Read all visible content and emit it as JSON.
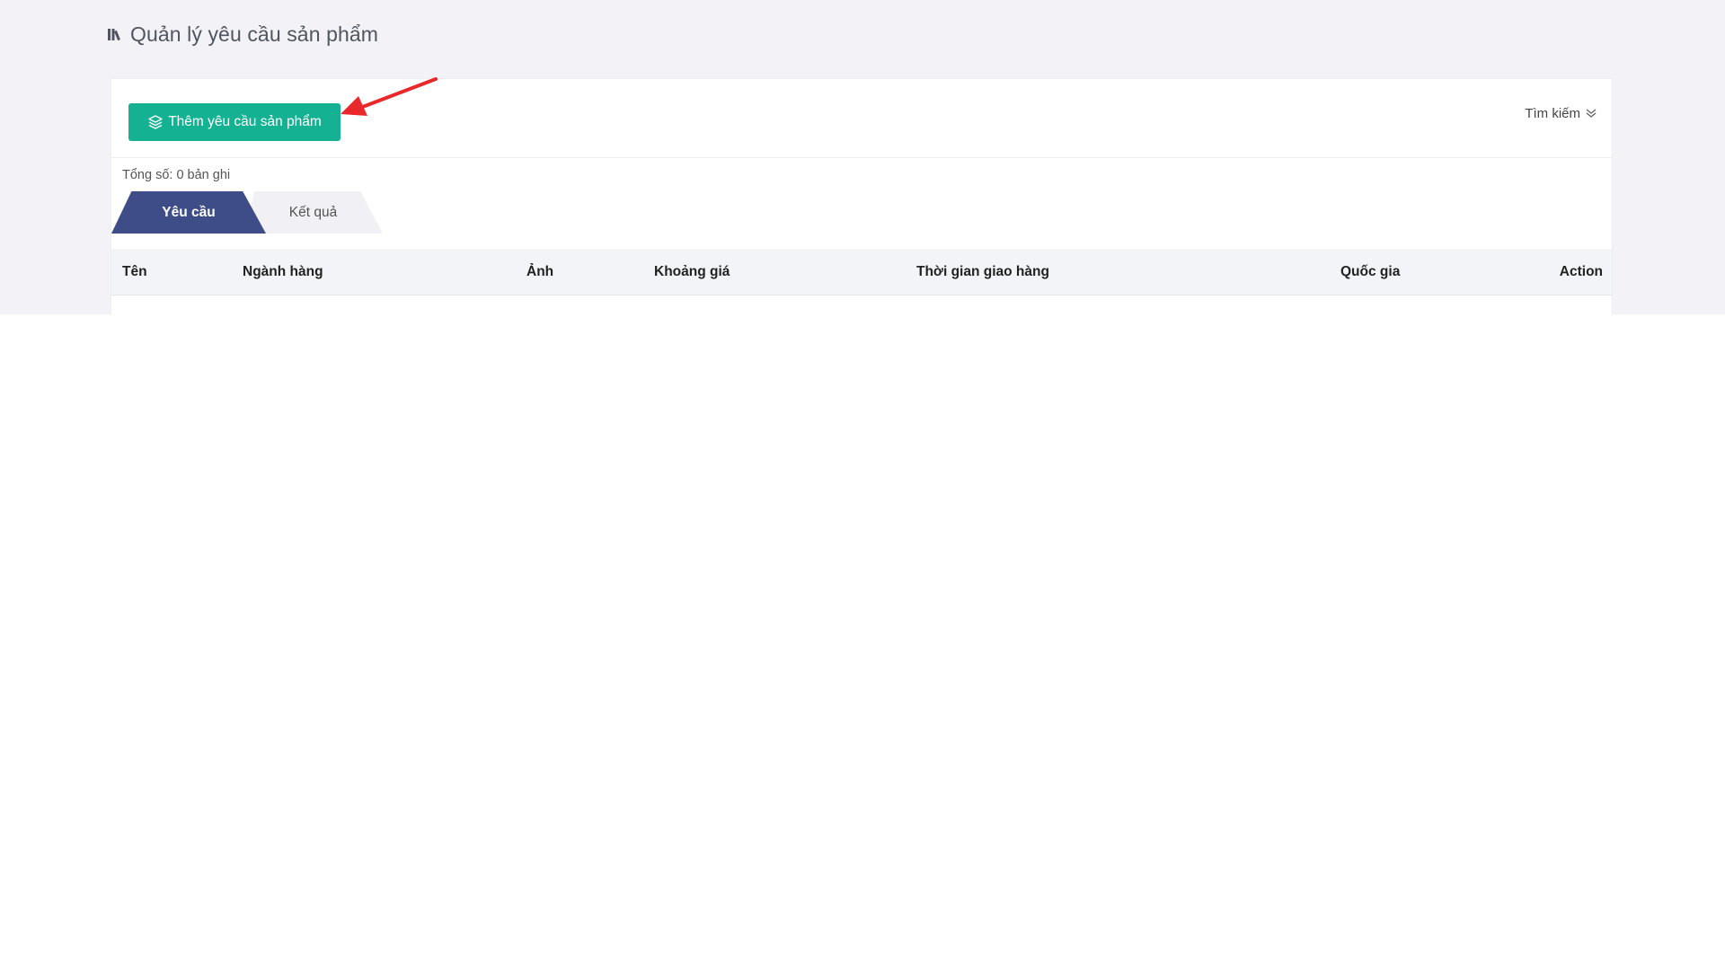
{
  "header": {
    "title": "Quản lý yêu cầu sản phẩm",
    "icon": "books-icon"
  },
  "toolbar": {
    "add_label": "Thêm yêu cầu sản phẩm",
    "add_icon": "layers-icon",
    "search_label": "Tìm kiếm",
    "search_icon": "double-chevron-down-icon"
  },
  "summary": {
    "total_label": "Tổng số: 0 bản ghi"
  },
  "tabs": [
    {
      "label": "Yêu cầu",
      "active": true
    },
    {
      "label": "Kết quả",
      "active": false
    }
  ],
  "table": {
    "columns": [
      "Tên",
      "Ngành hàng",
      "Ảnh",
      "Khoảng giá",
      "Thời gian giao hàng",
      "Quốc gia",
      "Action"
    ],
    "rows": []
  },
  "colors": {
    "accent_button": "#14b193",
    "active_tab": "#3e4d87",
    "inactive_tab": "#f0f0f5",
    "page_band": "#f2f2f7",
    "annotation_arrow": "#e8282b"
  }
}
